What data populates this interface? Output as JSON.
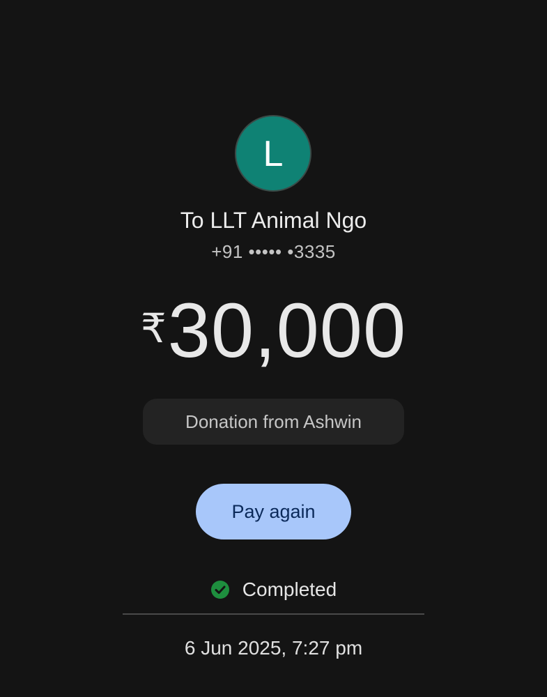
{
  "payee": {
    "avatar_letter": "L",
    "avatar_color": "#0f8274",
    "name": "To LLT Animal Ngo",
    "phone": "+91 ••••• •3335"
  },
  "amount": {
    "currency_symbol": "₹",
    "value": "30,000"
  },
  "note": "Donation from Ashwin",
  "actions": {
    "pay_again_label": "Pay again",
    "pay_again_color": "#a8c7fa"
  },
  "status": {
    "icon": "check-circle-icon",
    "icon_color": "#1e8e3e",
    "label": "Completed"
  },
  "datetime": "6 Jun 2025, 7:27 pm"
}
